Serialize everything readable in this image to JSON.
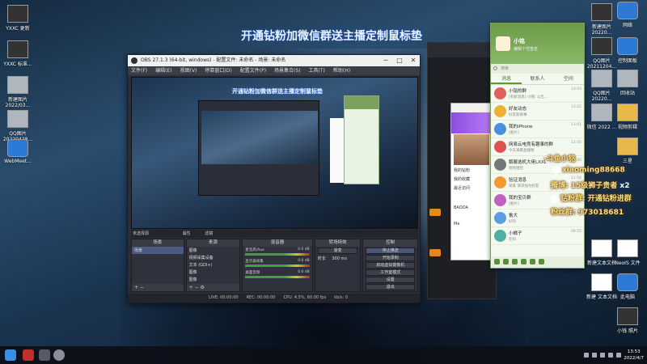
{
  "banner": "开通钻粉加微信群送主播定制鼠标垫",
  "desktop_left": [
    {
      "label": "YXXC 更新"
    },
    {
      "label": "YXXC 标准..."
    },
    {
      "label": "新建图片 2022/03..."
    },
    {
      "label": "QQ图片 20220428..."
    },
    {
      "label": "WebMeet..."
    }
  ],
  "desktop_right": [
    {
      "label": "网络"
    },
    {
      "label": "控制面板"
    },
    {
      "label": "回收站"
    },
    {
      "label": "视频剪辑"
    },
    {
      "label": "三星"
    },
    {
      "label": "NeoIS 文件"
    },
    {
      "label": "此电脑"
    },
    {
      "label": "小钱 照片"
    }
  ],
  "desktop_mid_right": [
    {
      "label": "新建图片 20220..."
    },
    {
      "label": "QQ图片 20211204..."
    },
    {
      "label": "QQ图片 20220..."
    },
    {
      "label": "微信 2022 ..."
    },
    {
      "label": "新建文本文档"
    },
    {
      "label": "新建 文本文档"
    }
  ],
  "obs": {
    "title": "OBS 27.1.3 (64-bit, windows) - 配置文件: 未命名 - 场景: 未命名",
    "menu": [
      "文件(F)",
      "编辑(E)",
      "视图(V)",
      "停靠窗口(D)",
      "配置文件(P)",
      "场景集合(S)",
      "工具(T)",
      "帮助(H)"
    ],
    "preview_banner": "开通钻粉加微信群送主播定制鼠标垫",
    "scene_bar": "未选择源",
    "scene_bar_props": "属性",
    "scene_bar_filters": "滤镜",
    "docks": {
      "scenes": {
        "title": "场景",
        "items": [
          "场景"
        ]
      },
      "sources": {
        "title": "来源",
        "items": [
          "图像",
          "视频采集设备",
          "文本 (GDI+)",
          "图像",
          "图像",
          "显示器采集"
        ]
      },
      "mixer": {
        "title": "混音器",
        "tracks": [
          {
            "name": "麦克风/Aux",
            "db": "0.0 dB"
          },
          {
            "name": "显示器采集",
            "db": "0.0 dB"
          },
          {
            "name": "桌面音频",
            "db": "0.0 dB"
          }
        ]
      },
      "transitions": {
        "title": "转场特效",
        "type": "渐变",
        "duration_label": "时长",
        "duration": "300 ms"
      },
      "controls": {
        "title": "控制",
        "buttons": [
          "停止推流",
          "开始录制",
          "启动虚拟摄像机",
          "工作室模式",
          "设置",
          "退出"
        ]
      }
    },
    "status": {
      "live": "LIVE: 00:00:00",
      "rec": "REC: 00:00:00",
      "cpu": "CPU: 4.5%, 60.00 fps",
      "kbps": "kb/s: 0"
    }
  },
  "purple_app": {
    "items": [
      "我的钻粉",
      "我的收藏",
      "最近访问",
      "BAODA",
      "Me"
    ]
  },
  "qq": {
    "name": "小铭",
    "signature": "编辑个性签名",
    "search_placeholder": "搜索",
    "tabs": [
      "消息",
      "联系人",
      "空间"
    ],
    "rows": [
      {
        "name": "小铭的群",
        "msg": "[有新消息] 小铭: 公告...",
        "time": "13:43",
        "color": "#e06060"
      },
      {
        "name": "好友动态",
        "msg": "好友新鲜事",
        "time": "13:22",
        "color": "#f0b030"
      },
      {
        "name": "我的iPhone",
        "msg": "[图片]",
        "time": "13:01",
        "color": "#4a8fe0"
      },
      {
        "name": "网易云电竞有趣事的群",
        "msg": "今天来看直播啦",
        "time": "12:45",
        "color": "#e05050"
      },
      {
        "name": "鹅展选机大佬LXXL",
        "msg": "哈哈哈哈",
        "time": "12:30",
        "color": "#777777"
      },
      {
        "name": "验证消息",
        "msg": "某某 请求加为好友",
        "time": "11:58",
        "color": "#f09a30"
      },
      {
        "name": "我的宝贝群",
        "msg": "[图片]",
        "time": "11:40",
        "color": "#c060c0"
      },
      {
        "name": "鲁大",
        "msg": "好的",
        "time": "10:12",
        "color": "#5aa0e0"
      },
      {
        "name": "小橘子",
        "msg": "在吗",
        "time": "09:55",
        "color": "#50b0a0"
      }
    ]
  },
  "overlays": {
    "douyin": "-斗鱼小铭",
    "tiktok": "xiaoming88668",
    "weibo": "腾博: 15级狮子贵者",
    "multiplier": "x2",
    "fans": "钻粉群: 开通钻粉进群",
    "fansgroup": "粉丝群: 973018681"
  },
  "taskbar": {
    "time": "13:53",
    "date": "2022/4/7"
  }
}
